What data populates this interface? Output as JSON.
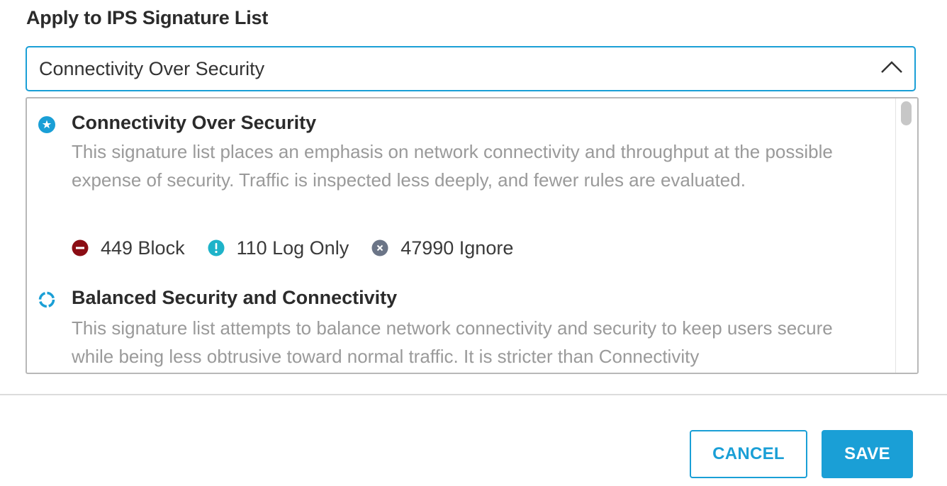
{
  "field": {
    "label": "Apply to IPS Signature List"
  },
  "select": {
    "value": "Connectivity Over Security",
    "chevron_icon": "chevron-up-icon"
  },
  "options": [
    {
      "title": "Connectivity Over Security",
      "selected": true,
      "description": "This signature list places an emphasis on network connectivity and throughput at the possible expense of security. Traffic is inspected less deeply, and fewer rules are evaluated.",
      "stats": {
        "block": "449 Block",
        "log_only": "110 Log Only",
        "ignore": "47990 Ignore"
      }
    },
    {
      "title": "Balanced Security and Connectivity",
      "selected": false,
      "description": "This signature list attempts to balance network connectivity and security to keep users secure while being less obtrusive toward normal traffic. It is stricter than Connectivity"
    }
  ],
  "colors": {
    "accent": "#1a9fd6",
    "block": "#8b0d14",
    "log_only": "#1eb3c9",
    "ignore": "#6b7587"
  },
  "footer": {
    "cancel_label": "CANCEL",
    "save_label": "SAVE"
  }
}
